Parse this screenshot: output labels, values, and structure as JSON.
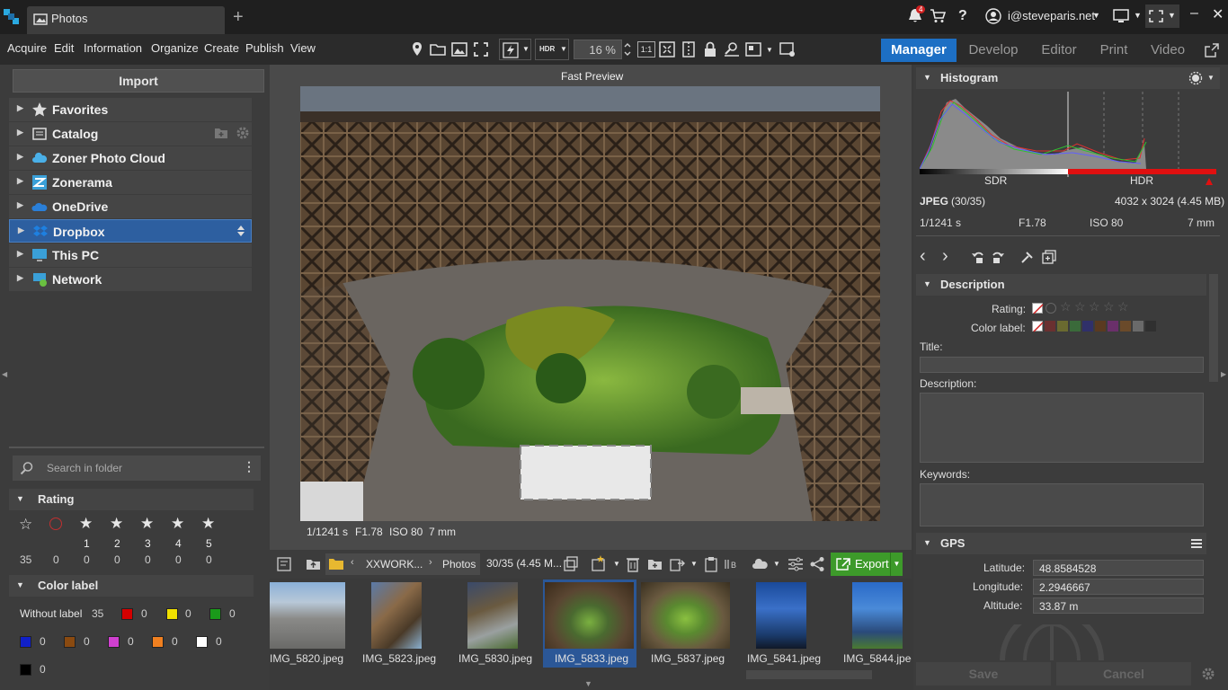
{
  "app": {
    "tab_title": "Photos",
    "user": "i@steveparis.net",
    "notification_count": "4"
  },
  "menu": [
    "Acquire",
    "Edit",
    "Information",
    "Organize",
    "Create",
    "Publish",
    "View"
  ],
  "toolbar": {
    "hdr_label": "HDR",
    "zoom": "16 %",
    "one_to_one": "1:1"
  },
  "modes": {
    "manager": "Manager",
    "develop": "Develop",
    "editor": "Editor",
    "print": "Print",
    "video": "Video"
  },
  "left": {
    "import_label": "Import",
    "tree": [
      "Favorites",
      "Catalog",
      "Zoner Photo Cloud",
      "Zonerama",
      "OneDrive",
      "Dropbox",
      "This PC",
      "Network"
    ],
    "search_placeholder": "Search in folder",
    "rating_header": "Rating",
    "rating_numbers": [
      "1",
      "2",
      "3",
      "4",
      "5"
    ],
    "rating_counts": [
      "35",
      "0",
      "0",
      "0",
      "0",
      "0",
      "0",
      "0"
    ],
    "color_header": "Color label",
    "without_label": "Without label",
    "without_count": "35",
    "color_counts": [
      "0",
      "0",
      "0",
      "0",
      "0",
      "0",
      "0",
      "0",
      "0"
    ],
    "colors": [
      "#d40000",
      "#f0e000",
      "#1a9a1a",
      "#1020c8",
      "#8a4a10",
      "#d040d0",
      "#f08020",
      "#ffffff",
      "#000000"
    ]
  },
  "center": {
    "preview_label": "Fast Preview",
    "exif": {
      "shutter": "1/1241 s",
      "aperture": "F1.78",
      "iso": "ISO 80",
      "focal": "7 mm"
    },
    "breadcrumb": {
      "folder": "XXWORK...",
      "sub": "Photos",
      "count": "30/35 (4.45 M..."
    },
    "export_label": "Export",
    "thumbs": [
      "IMG_5820.jpeg",
      "IMG_5823.jpeg",
      "IMG_5830.jpeg",
      "IMG_5833.jpeg",
      "IMG_5837.jpeg",
      "IMG_5841.jpeg",
      "IMG_5844.jpeg"
    ]
  },
  "right": {
    "histogram_header": "Histogram",
    "sdr": "SDR",
    "hdr": "HDR",
    "format": "JPEG",
    "index": "(30/35)",
    "dimensions": "4032 x 3024 (4.45 MB)",
    "shutter": "1/1241 s",
    "aperture": "F1.78",
    "iso": "ISO 80",
    "focal": "7 mm",
    "description_header": "Description",
    "rating_label": "Rating:",
    "color_label": "Color label:",
    "title_label": "Title:",
    "desc_label": "Description:",
    "keywords_label": "Keywords:",
    "gps_header": "GPS",
    "latitude_label": "Latitude:",
    "latitude": "48.8584528",
    "longitude_label": "Longitude:",
    "longitude": "2.2946667",
    "altitude_label": "Altitude:",
    "altitude": "33.87 m",
    "save": "Save",
    "cancel": "Cancel",
    "label_colors": [
      "#6a3030",
      "#6a6a30",
      "#3a6a3a",
      "#30306a",
      "#5a3a20",
      "#6a306a",
      "#6a4a2a",
      "#6a6a6a",
      "#303030"
    ]
  }
}
